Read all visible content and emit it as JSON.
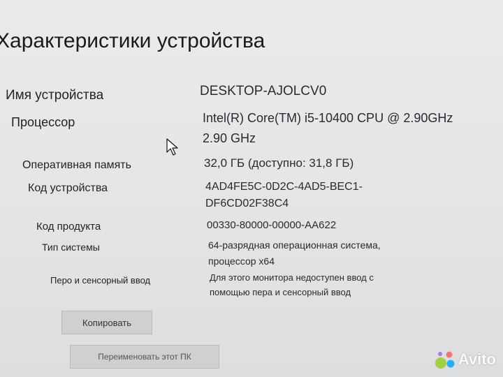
{
  "section": {
    "title": "Характеристики устройства"
  },
  "specs": {
    "device_name": {
      "label": "Имя устройства",
      "value": "DESKTOP-AJOLCV0"
    },
    "processor": {
      "label": "Процессор",
      "value_line1": "Intel(R) Core(TM) i5-10400 CPU @ 2.90GHz",
      "value_line2": "2.90 GHz"
    },
    "ram": {
      "label": "Оперативная память",
      "value": "32,0 ГБ (доступно: 31,8 ГБ)"
    },
    "device_id": {
      "label": "Код устройства",
      "value_line1": "4AD4FE5C-0D2C-4AD5-BEC1-",
      "value_line2": "DF6CD02F38C4"
    },
    "product_id": {
      "label": "Код продукта",
      "value": "00330-80000-00000-AA622"
    },
    "system_type": {
      "label": "Тип системы",
      "value_line1": "64-разрядная операционная система,",
      "value_line2": "процессор x64"
    },
    "pen_touch": {
      "label": "Перо и сенсорный ввод",
      "value_line1": "Для этого монитора недоступен ввод с",
      "value_line2": "помощью пера и сенсорный ввод"
    }
  },
  "buttons": {
    "copy": "Копировать",
    "rename": "Переименовать этот ПК"
  },
  "watermark": {
    "text": "Avito",
    "dot_colors": [
      "#97cf26",
      "#00aaff",
      "#ff6163",
      "#a169f7"
    ]
  }
}
